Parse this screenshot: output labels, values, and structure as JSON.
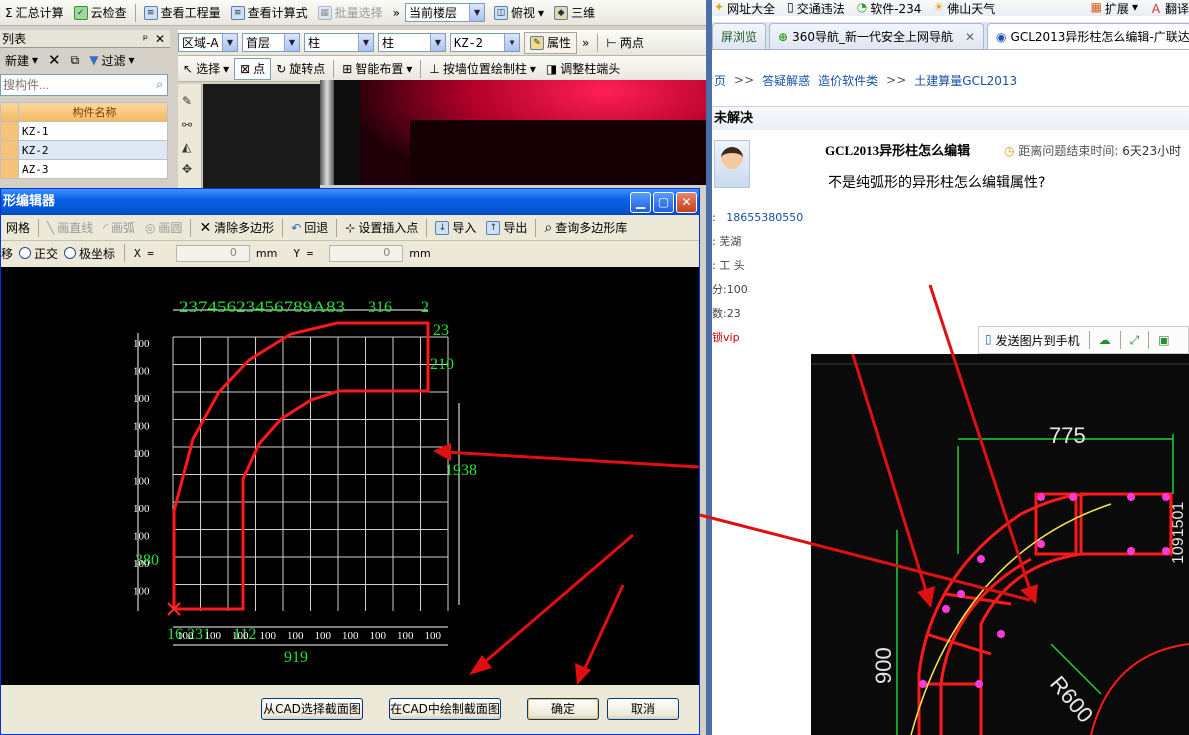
{
  "left_app": {
    "toolbar1": {
      "summary": "汇总计算",
      "cloud_check": "云检查",
      "view_quantity": "查看工程量",
      "view_formula": "查看计算式",
      "batch_select": "批量选择",
      "floor": "当前楼层",
      "view": "俯视",
      "three_d": "三维"
    },
    "toolbar2": {
      "region": "区域-A",
      "floor": "首层",
      "type1": "柱",
      "type2": "柱",
      "component": "KZ-2",
      "properties": "属性",
      "two_points": "两点"
    },
    "toolbar3": {
      "select": "选择",
      "point": "点",
      "rotate_point": "旋转点",
      "smart_layout": "智能布置",
      "draw_by_wall": "按墙位置绘制柱",
      "adjust_column_end": "调整柱端头"
    },
    "panel": {
      "title": "列表",
      "new": "新建",
      "filter": "过滤",
      "search_placeholder": "搜构件...",
      "column_header": "构件名称",
      "rows": [
        "KZ-1",
        "KZ-2",
        "AZ-3"
      ]
    }
  },
  "dialog": {
    "title": "形编辑器",
    "toolbar": {
      "grid": "网格",
      "draw_line": "画直线",
      "draw_arc": "画弧",
      "draw_circle": "画圆",
      "clear_polygon": "清除多边形",
      "undo": "回退",
      "set_insert_point": "设置插入点",
      "import": "导入",
      "export": "导出",
      "query_library": "查询多边形库"
    },
    "coords": {
      "move": "移",
      "ortho": "正交",
      "polar": "极坐标",
      "x_label": "X =",
      "x_value": "0",
      "y_label": "Y =",
      "y_value": "0",
      "unit": "mm"
    },
    "dims": {
      "top_overlap": "23745623456789A83",
      "top_316": "316",
      "top_2": "2",
      "right_23": "23",
      "right_210": "210",
      "right_1938": "1938",
      "left_380": "380",
      "bottom_231": "16 231",
      "bottom_12": "112",
      "bottom_919": "919",
      "grid_100": "100"
    },
    "buttons": {
      "select_from_cad": "从CAD选择截面图",
      "draw_in_cad": "在CAD中绘制截面图",
      "ok": "确定",
      "cancel": "取消"
    }
  },
  "browser": {
    "favorites": {
      "site_nav": "网址大全",
      "traffic": "交通违法",
      "software": "软件-234",
      "weather": "佛山天气",
      "extend": "扩展",
      "translate": "翻译"
    },
    "tabs": {
      "tab1": "屏浏览",
      "tab2": "360导航_新一代安全上网导航",
      "tab3": "GCL2013异形柱怎么编辑-广联达"
    },
    "breadcrumb": {
      "home": "页",
      "qa": "答疑解惑",
      "cost_software": "造价软件类",
      "gcl": "土建算量GCL2013"
    },
    "section": "未解决",
    "question": {
      "title": "GCL2013异形柱怎么编辑",
      "time_label": "距离问题结束时间:",
      "time_value": "6天23小时",
      "body": "不是纯弧形的异形柱怎么编辑属性?"
    },
    "user": {
      "phone": "18655380550",
      "region": "芜湖",
      "title": "工    头",
      "points": "分:100",
      "answers": "数:23",
      "vip": "锁vip"
    },
    "image_toolbar": {
      "send_to_phone": "发送图片到手机"
    },
    "cad_image": {
      "dim_775": "775",
      "dim_900": "900",
      "dim_r600": "R600",
      "dim_top_right": "1091501"
    }
  }
}
